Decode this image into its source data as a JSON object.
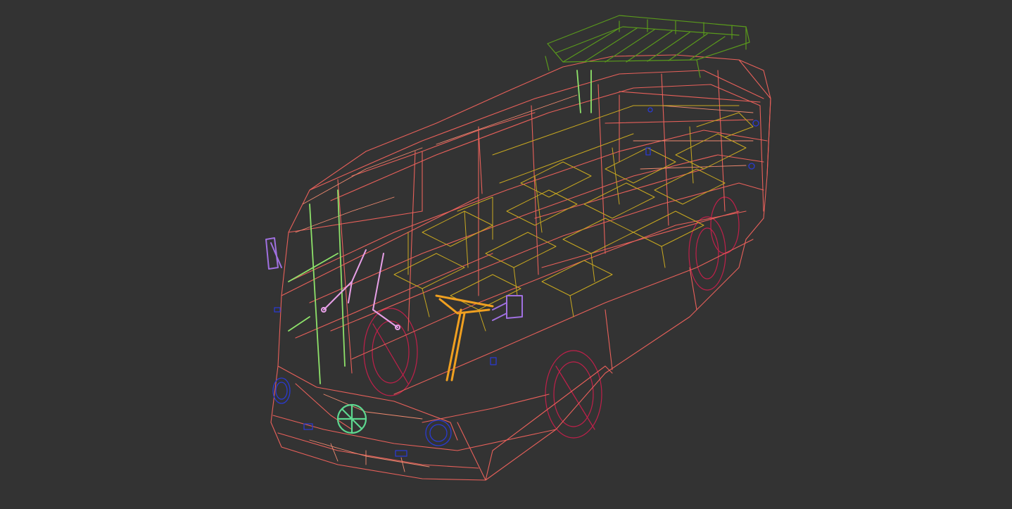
{
  "viewport": {
    "background": "#333333"
  },
  "model": {
    "colors": {
      "body": "#e8605a",
      "body_light": "#f08a70",
      "seats": "#c8a820",
      "roof_rack": "#5a9a1c",
      "door_frame": "#8ee26a",
      "wheels": "#c0204a",
      "lights": "#2a3ad0",
      "light_inner": "#4060ff",
      "mirrors": "#a070e0",
      "wipers": "#e8a0e8",
      "steering": "#f0a020",
      "emblem": "#5ed890"
    }
  }
}
